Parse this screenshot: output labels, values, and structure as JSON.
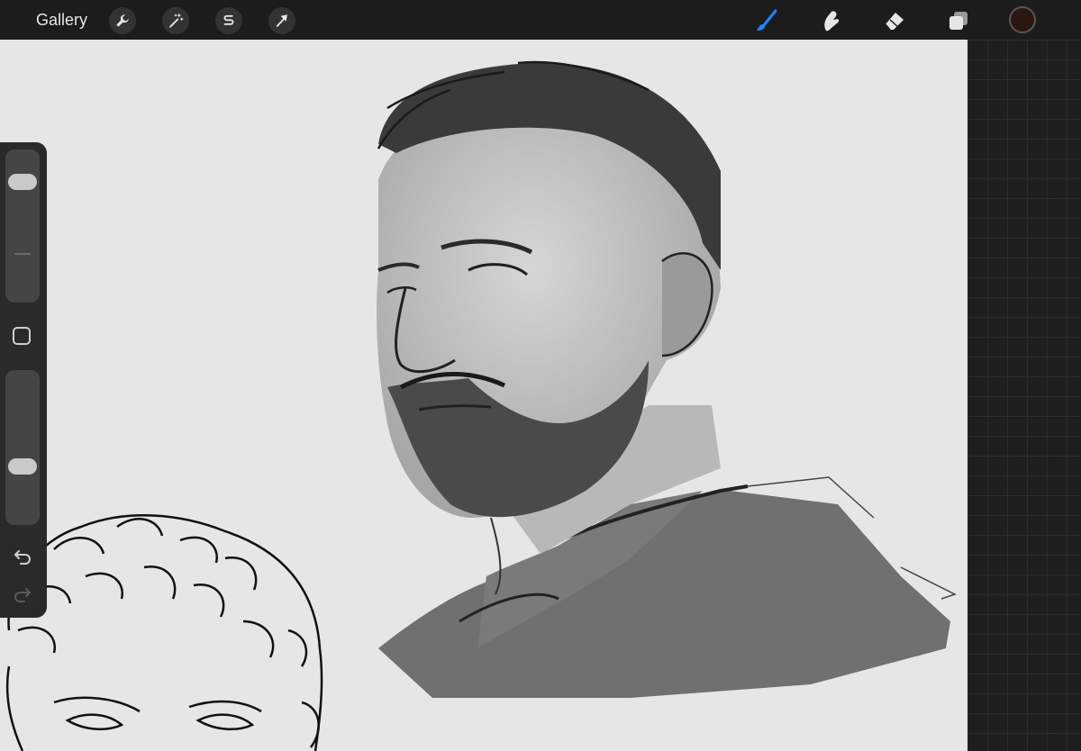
{
  "topbar": {
    "gallery_label": "Gallery",
    "left_tools": [
      {
        "icon": "wrench-icon",
        "name": "actions"
      },
      {
        "icon": "magic-wand-icon",
        "name": "adjustments"
      },
      {
        "icon": "selection-s-icon",
        "name": "selection"
      },
      {
        "icon": "arrow-cursor-icon",
        "name": "transform"
      }
    ],
    "right_tools": [
      {
        "icon": "brush-icon",
        "name": "paint",
        "active": true
      },
      {
        "icon": "smudge-icon",
        "name": "smudge",
        "active": false
      },
      {
        "icon": "eraser-icon",
        "name": "erase",
        "active": false
      },
      {
        "icon": "layers-icon",
        "name": "layers",
        "active": false
      }
    ],
    "current_color": "#2b1710",
    "active_color": "#1e88ff"
  },
  "sidebar": {
    "brush_size_level": 0.85,
    "opacity_level": 0.35,
    "icons": [
      "modify-square-icon",
      "undo-icon",
      "redo-icon"
    ]
  },
  "colors": {
    "canvas": "#e6e6e6",
    "interface": "#1c1c1c"
  }
}
